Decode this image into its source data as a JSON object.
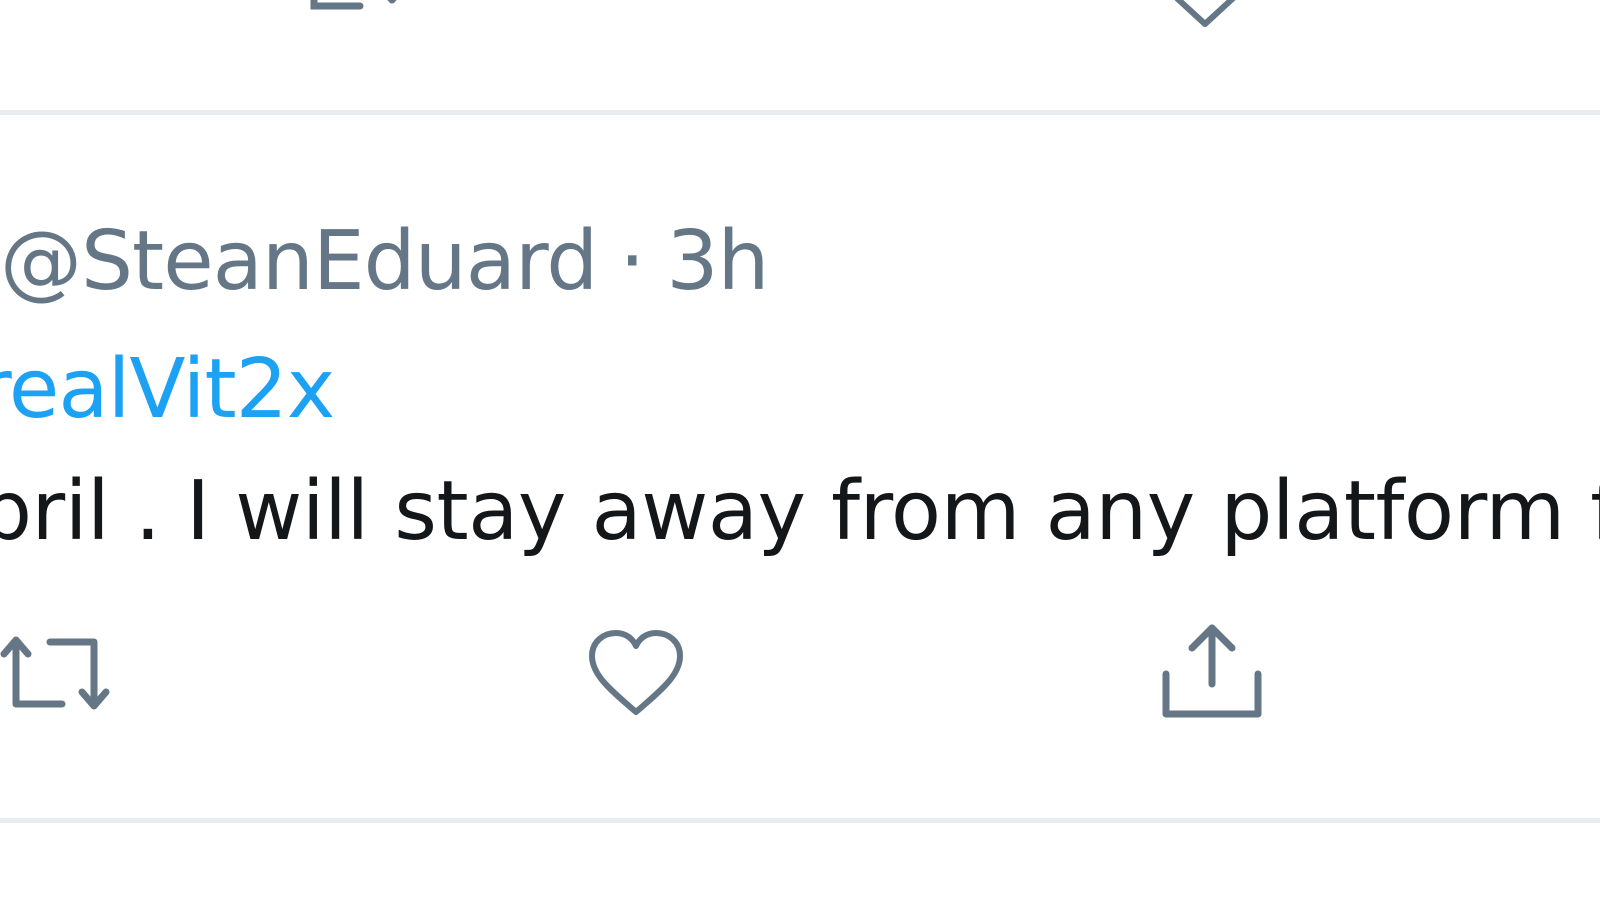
{
  "tweet": {
    "handle": "@SteanEduard",
    "separator": "·",
    "time": "3h",
    "reply_to": "realVit2x",
    "text": "pril . I will stay away from any platform for"
  },
  "actions": [
    {
      "name": "retweet",
      "icon": "retweet-icon"
    },
    {
      "name": "like",
      "icon": "heart-icon"
    },
    {
      "name": "share",
      "icon": "share-icon"
    }
  ],
  "colors": {
    "muted": "#657786",
    "link": "#1da1f2",
    "text": "#14171a",
    "divider": "#e6ecf0"
  }
}
